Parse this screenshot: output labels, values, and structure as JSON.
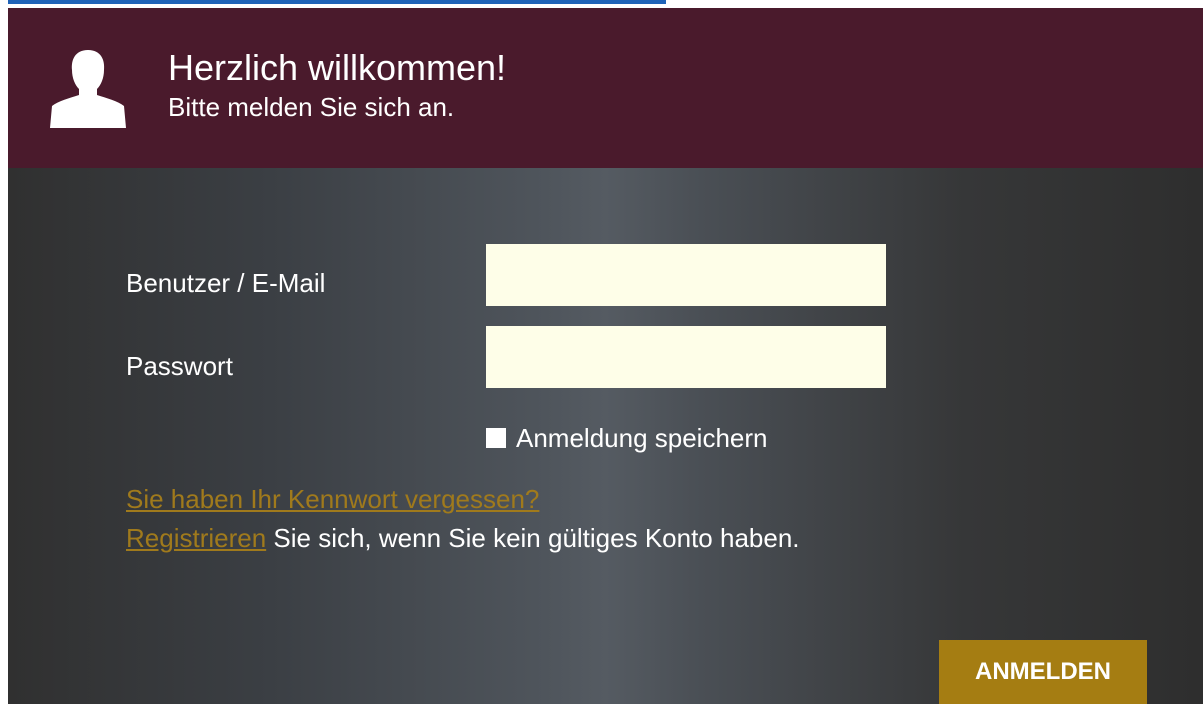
{
  "header": {
    "title": "Herzlich willkommen!",
    "subtitle": "Bitte melden Sie sich an.",
    "icon": "user-silhouette-icon"
  },
  "form": {
    "user_label": "Benutzer / E-Mail",
    "user_value": "",
    "password_label": "Passwort",
    "password_value": "",
    "remember_label": "Anmeldung speichern",
    "remember_checked": false
  },
  "links": {
    "forgot_password": "Sie haben Ihr Kennwort vergessen?",
    "register_link": "Registrieren",
    "register_text": " Sie sich, wenn Sie kein gültiges Konto haben."
  },
  "actions": {
    "login_label": "ANMELDEN"
  },
  "colors": {
    "header_bg": "#4a1a2c",
    "accent": "#a57d12",
    "link": "#a07a1c",
    "field_bg": "#fefee8"
  }
}
